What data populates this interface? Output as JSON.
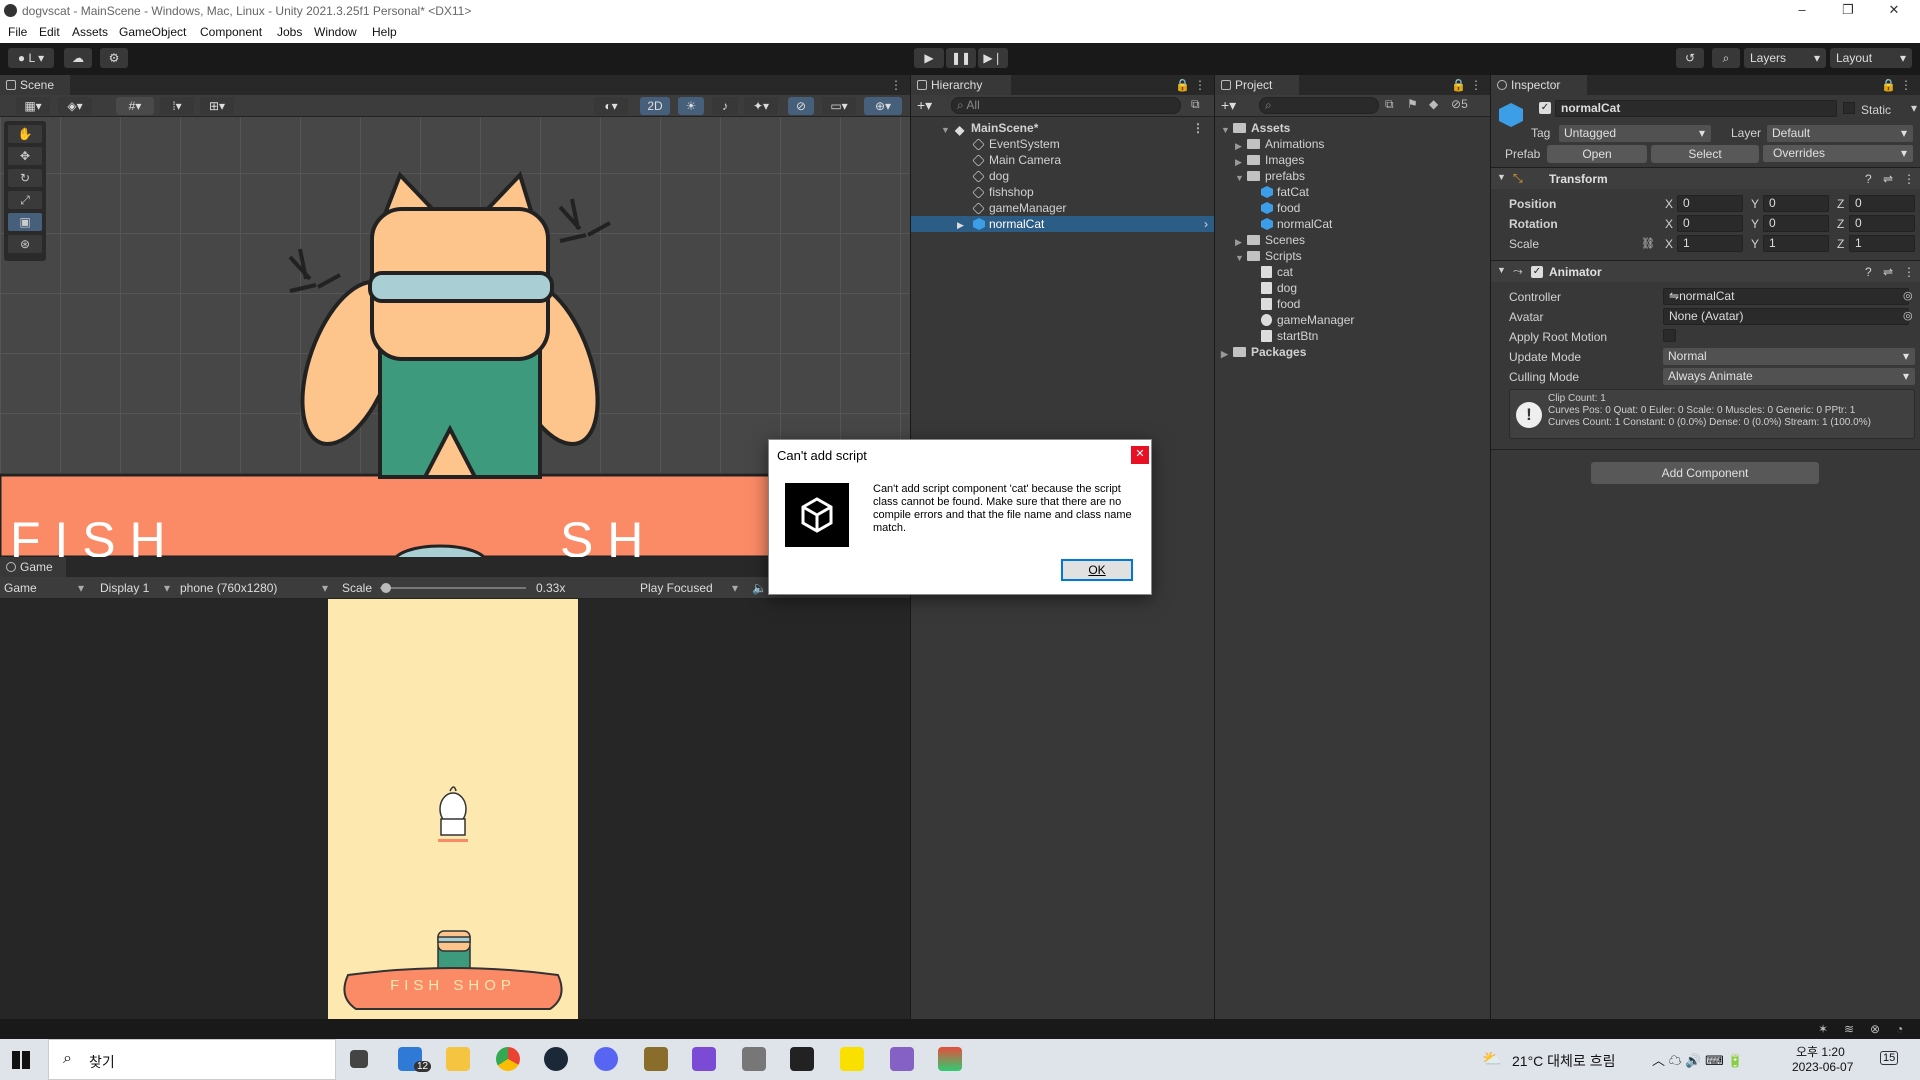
{
  "window": {
    "title": "dogvscat - MainScene - Windows, Mac, Linux - Unity 2021.3.25f1 Personal* <DX11>"
  },
  "menu": [
    "File",
    "Edit",
    "Assets",
    "GameObject",
    "Component",
    "Jobs",
    "Window",
    "Help"
  ],
  "toolbar": {
    "account_label": "L",
    "layers_label": "Layers",
    "layout_label": "Layout"
  },
  "scene": {
    "tab_label": "Scene",
    "mode_2d_label": "2D"
  },
  "game": {
    "tab_label": "Game",
    "view_select": "Game",
    "display_select": "Display 1",
    "resolution_select": "phone (760x1280)",
    "scale_label": "Scale",
    "scale_value": "0.33x",
    "play_focused_select": "Play Focused",
    "sign_text": "FISH SHOP"
  },
  "hierarchy": {
    "tab_label": "Hierarchy",
    "search_placeholder": "All",
    "scene_name": "MainScene*",
    "items": [
      "EventSystem",
      "Main Camera",
      "dog",
      "fishshop",
      "gameManager",
      "normalCat"
    ],
    "selected": "normalCat"
  },
  "project": {
    "tab_label": "Project",
    "hidden_count": "5",
    "assets_label": "Assets",
    "folders": {
      "animations": "Animations",
      "images": "Images",
      "prefabs": "prefabs",
      "scenes": "Scenes",
      "scripts": "Scripts"
    },
    "prefab_items": [
      "fatCat",
      "food",
      "normalCat"
    ],
    "script_items": [
      "cat",
      "dog",
      "food",
      "gameManager",
      "startBtn"
    ],
    "packages_label": "Packages"
  },
  "inspector": {
    "tab_label": "Inspector",
    "object_name": "normalCat",
    "static_label": "Static",
    "tag_label": "Tag",
    "tag_value": "Untagged",
    "layer_label": "Layer",
    "layer_value": "Default",
    "prefab_label": "Prefab",
    "open_label": "Open",
    "select_label": "Select",
    "overrides_label": "Overrides",
    "transform": {
      "title": "Transform",
      "position_label": "Position",
      "rotation_label": "Rotation",
      "scale_label": "Scale",
      "position": {
        "x": "0",
        "y": "0",
        "z": "0"
      },
      "rotation": {
        "x": "0",
        "y": "0",
        "z": "0"
      },
      "scale": {
        "x": "1",
        "y": "1",
        "z": "1"
      }
    },
    "animator": {
      "title": "Animator",
      "controller_label": "Controller",
      "controller_value": "normalCat",
      "avatar_label": "Avatar",
      "avatar_value": "None (Avatar)",
      "root_motion_label": "Apply Root Motion",
      "update_mode_label": "Update Mode",
      "update_mode_value": "Normal",
      "culling_mode_label": "Culling Mode",
      "culling_mode_value": "Always Animate",
      "info_line1": "Clip Count: 1",
      "info_line2": "Curves Pos: 0 Quat: 0 Euler: 0 Scale: 0 Muscles: 0 Generic: 0 PPtr: 1",
      "info_line3": "Curves Count: 1 Constant: 0 (0.0%) Dense: 0 (0.0%) Stream: 1 (100.0%)"
    },
    "add_component_label": "Add Component"
  },
  "dialog": {
    "title": "Can't add script",
    "message": "Can't add script component 'cat' because the script class cannot be found. Make sure that there are no compile errors and that the file name and class name match.",
    "ok_label": "OK"
  },
  "taskbar": {
    "search_label": "찾기",
    "mail_badge": "12",
    "weather": "21°C 대체로 흐림",
    "time": "오후 1:20",
    "date": "2023-06-07",
    "notification_count": "15"
  },
  "colors": {
    "selection": "#2c5d87",
    "panel": "#383838",
    "cube_blue": "#3b9ee6",
    "counter_orange": "#fb8a66",
    "cat_skin": "#fdc58c",
    "apron_green": "#3d9a7c"
  }
}
